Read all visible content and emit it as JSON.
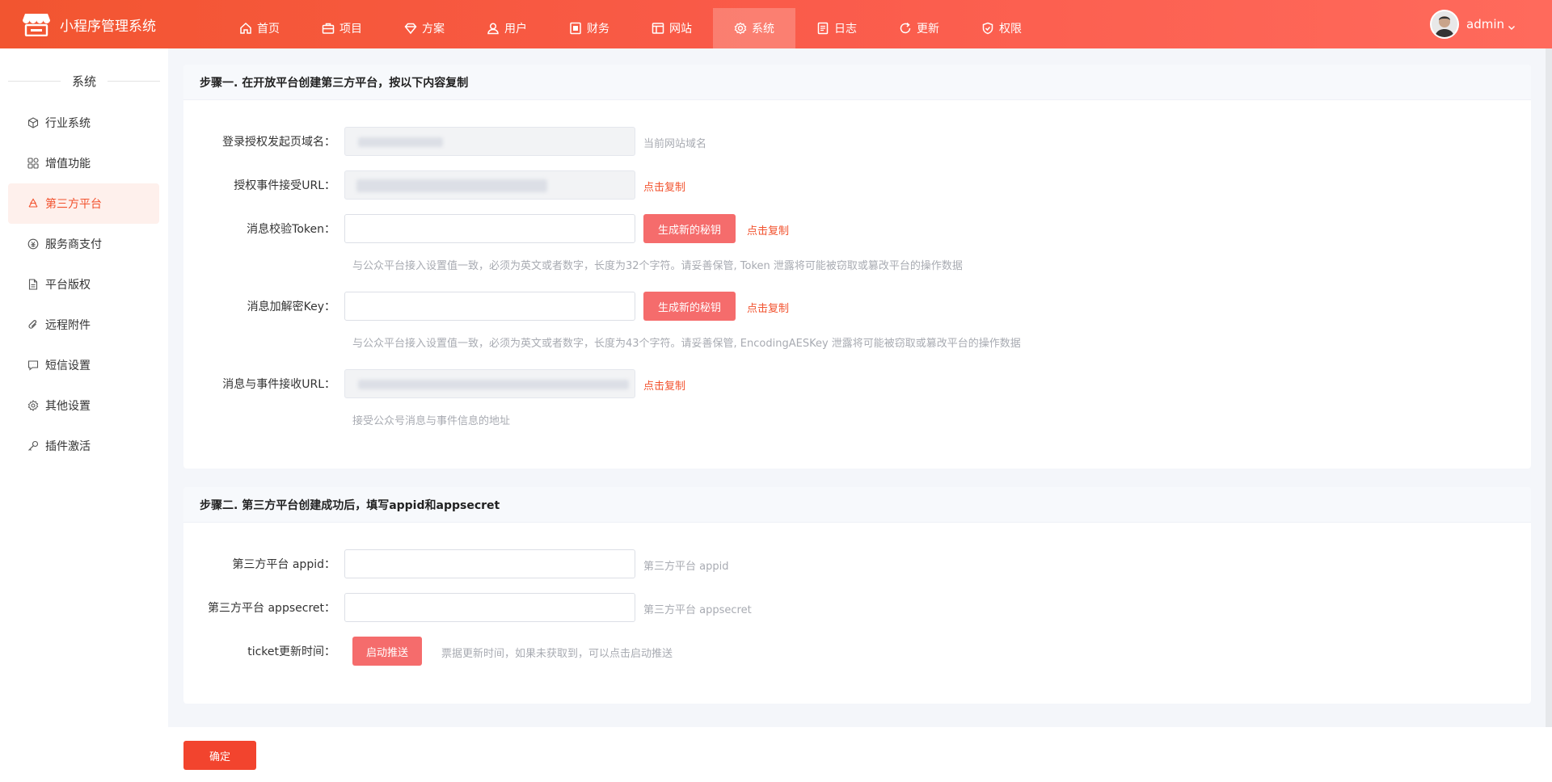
{
  "app": {
    "title": "小程序管理系统",
    "logo_icon": "store-icon"
  },
  "nav": [
    {
      "label": "首页",
      "icon": "home-icon",
      "active": false
    },
    {
      "label": "项目",
      "icon": "briefcase-icon",
      "active": false
    },
    {
      "label": "方案",
      "icon": "diamond-icon",
      "active": false
    },
    {
      "label": "用户",
      "icon": "user-icon",
      "active": false
    },
    {
      "label": "财务",
      "icon": "finance-icon",
      "active": false
    },
    {
      "label": "网站",
      "icon": "website-icon",
      "active": false
    },
    {
      "label": "系统",
      "icon": "gear-icon",
      "active": true
    },
    {
      "label": "日志",
      "icon": "log-icon",
      "active": false
    },
    {
      "label": "更新",
      "icon": "refresh-icon",
      "active": false
    },
    {
      "label": "权限",
      "icon": "shield-icon",
      "active": false
    }
  ],
  "user": {
    "name": "admin"
  },
  "sidebar": {
    "title": "系统",
    "items": [
      {
        "label": "行业系统",
        "icon": "cube-icon",
        "active": false
      },
      {
        "label": "增值功能",
        "icon": "grid-icon",
        "active": false
      },
      {
        "label": "第三方平台",
        "icon": "recycle-icon",
        "active": true
      },
      {
        "label": "服务商支付",
        "icon": "payment-icon",
        "active": false
      },
      {
        "label": "平台版权",
        "icon": "document-icon",
        "active": false
      },
      {
        "label": "远程附件",
        "icon": "paperclip-icon",
        "active": false
      },
      {
        "label": "短信设置",
        "icon": "message-icon",
        "active": false
      },
      {
        "label": "其他设置",
        "icon": "settings-icon",
        "active": false
      },
      {
        "label": "插件激活",
        "icon": "key-icon",
        "active": false
      }
    ]
  },
  "step1": {
    "title": "步骤一. 在开放平台创建第三方平台，按以下内容复制",
    "domain": {
      "label": "登录授权发起页域名：",
      "hint": "当前网站域名"
    },
    "auth_url": {
      "label": "授权事件接受URL：",
      "copy": "点击复制"
    },
    "token": {
      "label": "消息校验Token：",
      "gen_button": "生成新的秘钥",
      "copy": "点击复制",
      "help": "与公众平台接入设置值一致，必须为英文或者数字，长度为32个字符。请妥善保管, Token 泄露将可能被窃取或篡改平台的操作数据"
    },
    "aes_key": {
      "label": "消息加解密Key：",
      "gen_button": "生成新的秘钥",
      "copy": "点击复制",
      "help": "与公众平台接入设置值一致，必须为英文或者数字，长度为43个字符。请妥善保管, EncodingAESKey 泄露将可能被窃取或篡改平台的操作数据"
    },
    "msg_url": {
      "label": "消息与事件接收URL：",
      "copy": "点击复制",
      "help": "接受公众号消息与事件信息的地址"
    }
  },
  "step2": {
    "title": "步骤二. 第三方平台创建成功后，填写appid和appsecret",
    "appid": {
      "label": "第三方平台 appid：",
      "hint": "第三方平台 appid"
    },
    "appsecret": {
      "label": "第三方平台 appsecret：",
      "hint": "第三方平台 appsecret"
    },
    "ticket": {
      "label": "ticket更新时间：",
      "button": "启动推送",
      "hint": "票据更新时间，如果未获取到，可以点击启动推送"
    }
  },
  "footer": {
    "confirm": "确定"
  },
  "colors": {
    "header_start": "#f25530",
    "header_end": "#ff6a5c",
    "accent": "#f2522e",
    "button_light": "#f56c6c"
  }
}
